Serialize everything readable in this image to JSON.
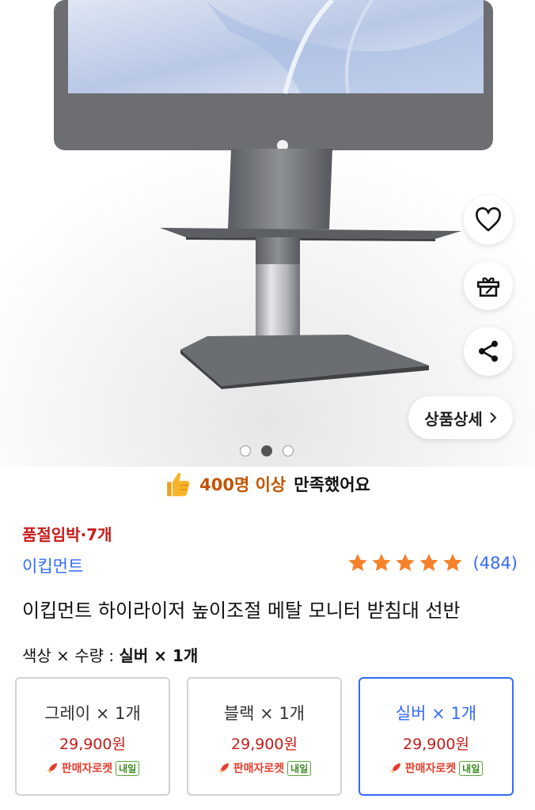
{
  "hero": {
    "detail_label": "상품상세",
    "dots": [
      false,
      true,
      false
    ]
  },
  "satisfaction": {
    "highlight": "400명 이상",
    "rest": "만족했어요"
  },
  "stock_text": "품절임박·7개",
  "brand": "이킵먼트",
  "rating": {
    "stars": 5,
    "count": "(484)"
  },
  "title": "이킵먼트 하이라이저 높이조절 메탈 모니터 받침대 선반",
  "option": {
    "label": "색상 × 수량 : ",
    "value": "실버 × 1개"
  },
  "options": [
    {
      "name": "그레이 × 1개",
      "price": "29,900원",
      "delivery": "판매자로켓",
      "tag": "내일",
      "selected": false
    },
    {
      "name": "블랙 × 1개",
      "price": "29,900원",
      "delivery": "판매자로켓",
      "tag": "내일",
      "selected": false
    },
    {
      "name": "실버 × 1개",
      "price": "29,900원",
      "delivery": "판매자로켓",
      "tag": "내일",
      "selected": true
    }
  ],
  "colors": {
    "accent": "#346aff",
    "price": "#c81a1a",
    "star": "#f5812a"
  }
}
